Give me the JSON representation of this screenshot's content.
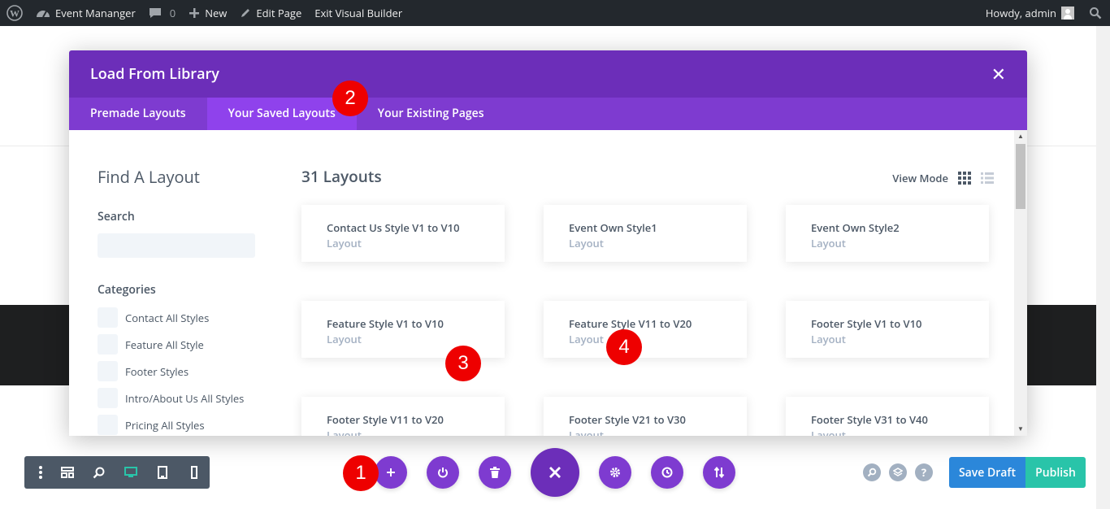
{
  "adminbar": {
    "site_name": "Event Mananger",
    "comments_count": "0",
    "new_label": "New",
    "edit_page_label": "Edit Page",
    "exit_builder_label": "Exit Visual Builder",
    "howdy": "Howdy, admin"
  },
  "modal": {
    "title": "Load From Library",
    "tabs": [
      {
        "label": "Premade Layouts"
      },
      {
        "label": "Your Saved Layouts"
      },
      {
        "label": "Your Existing Pages"
      }
    ],
    "sidebar": {
      "find_title": "Find A Layout",
      "search_label": "Search",
      "search_value": "",
      "categories_label": "Categories",
      "categories": [
        {
          "label": "Contact All Styles"
        },
        {
          "label": "Feature All Style"
        },
        {
          "label": "Footer Styles"
        },
        {
          "label": "Intro/About Us All Styles"
        },
        {
          "label": "Pricing All Styles"
        }
      ]
    },
    "count_title": "31 Layouts",
    "view_mode_label": "View Mode",
    "layouts": [
      {
        "title": "Contact Us Style V1 to V10",
        "type": "Layout"
      },
      {
        "title": "Event Own Style1",
        "type": "Layout"
      },
      {
        "title": "Event Own Style2",
        "type": "Layout"
      },
      {
        "title": "Feature Style V1 to V10",
        "type": "Layout"
      },
      {
        "title": "Feature Style V11 to V20",
        "type": "Layout"
      },
      {
        "title": "Footer Style V1 to V10",
        "type": "Layout"
      },
      {
        "title": "Footer Style V11 to V20",
        "type": "Layout"
      },
      {
        "title": "Footer Style V21 to V30",
        "type": "Layout"
      },
      {
        "title": "Footer Style V31 to V40",
        "type": "Layout"
      }
    ]
  },
  "markers": [
    "1",
    "2",
    "3",
    "4"
  ],
  "footer": {
    "save_draft_label": "Save Draft",
    "publish_label": "Publish"
  },
  "colors": {
    "purple_header": "#6c2eb9",
    "purple_tabs": "#7e3bd0",
    "marker_red": "#ee0000",
    "save_blue": "#2b87da",
    "publish_green": "#29c4a9"
  }
}
